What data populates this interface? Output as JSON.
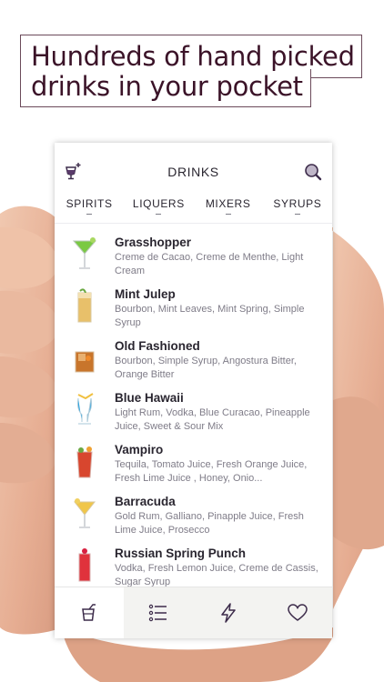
{
  "headline": "Hundreds of hand picked drinks in your pocket",
  "header": {
    "title": "DRINKS",
    "left_icon": "cocktail-glass-icon",
    "right_icon": "search-icon"
  },
  "tabs": [
    {
      "label": "SPIRITS"
    },
    {
      "label": "LIQUERS"
    },
    {
      "label": "MIXERS"
    },
    {
      "label": "SYRUPS"
    }
  ],
  "drinks": [
    {
      "name": "Grasshopper",
      "ingredients": "Creme de Cacao, Creme de Menthe, Light Cream",
      "color": "#7ac943"
    },
    {
      "name": "Mint Julep",
      "ingredients": "Bourbon, Mint Leaves, Mint Spring, Simple Syrup",
      "color": "#e8c06a"
    },
    {
      "name": "Old Fashioned",
      "ingredients": "Bourbon, Simple Syrup, Angostura Bitter, Orange Bitter",
      "color": "#c8752b"
    },
    {
      "name": "Blue Hawaii",
      "ingredients": "Light Rum, Vodka, Blue Curacao, Pineapple Juice, Sweet & Sour Mix",
      "color": "#2ba3e0"
    },
    {
      "name": "Vampiro",
      "ingredients": "Tequila, Tomato Juice, Fresh Orange Juice, Fresh Lime Juice , Honey, Onio...",
      "color": "#d8462e"
    },
    {
      "name": "Barracuda",
      "ingredients": "Gold Rum, Galliano, Pinapple Juice, Fresh Lime Juice, Prosecco",
      "color": "#f0c64a"
    },
    {
      "name": "Russian Spring Punch",
      "ingredients": "Vodka, Fresh Lemon Juice, Creme de Cassis, Sugar Syrup",
      "color": "#e0323c"
    }
  ],
  "bottom_nav": [
    {
      "icon": "drink-icon",
      "active": true
    },
    {
      "icon": "list-icon",
      "active": false
    },
    {
      "icon": "lightning-icon",
      "active": false
    },
    {
      "icon": "heart-icon",
      "active": false
    }
  ],
  "colors": {
    "headline_text": "#3b1328",
    "skin": "#e8b79c"
  }
}
